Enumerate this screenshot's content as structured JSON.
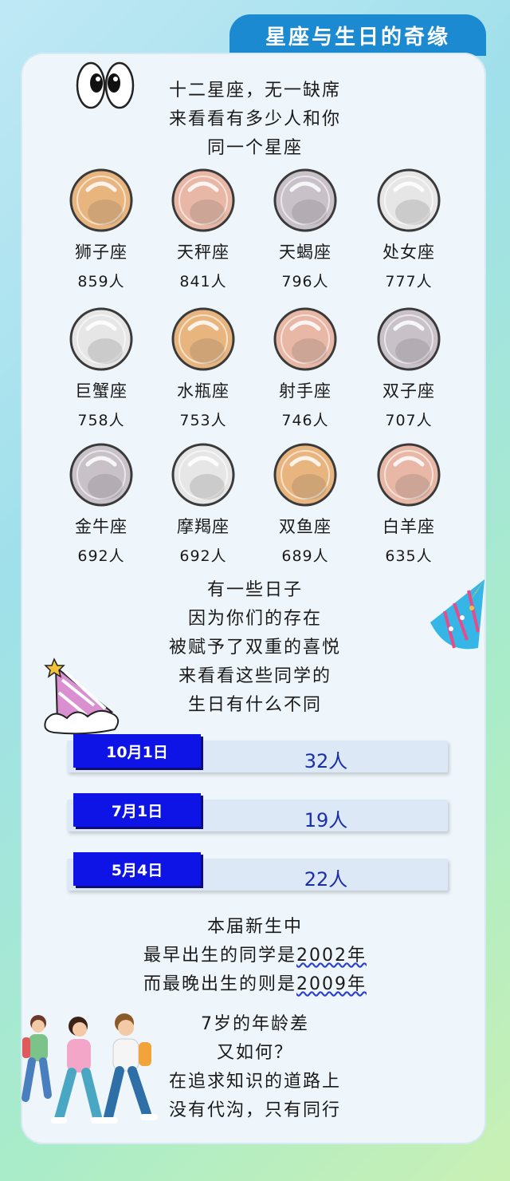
{
  "title": "星座与生日的奇缘",
  "intro": [
    "十二星座，无一缺席",
    "来看看有多少人和你",
    "同一个星座"
  ],
  "signs": [
    {
      "name": "狮子座",
      "count": "859人",
      "icon": "leo-icon"
    },
    {
      "name": "天秤座",
      "count": "841人",
      "icon": "libra-icon"
    },
    {
      "name": "天蝎座",
      "count": "796人",
      "icon": "scorpio-icon"
    },
    {
      "name": "处女座",
      "count": "777人",
      "icon": "virgo-icon"
    },
    {
      "name": "巨蟹座",
      "count": "758人",
      "icon": "cancer-icon"
    },
    {
      "name": "水瓶座",
      "count": "753人",
      "icon": "aquarius-icon"
    },
    {
      "name": "射手座",
      "count": "746人",
      "icon": "sagittarius-icon"
    },
    {
      "name": "双子座",
      "count": "707人",
      "icon": "gemini-icon"
    },
    {
      "name": "金牛座",
      "count": "692人",
      "icon": "taurus-icon"
    },
    {
      "name": "摩羯座",
      "count": "692人",
      "icon": "capricorn-icon"
    },
    {
      "name": "双鱼座",
      "count": "689人",
      "icon": "pisces-icon"
    },
    {
      "name": "白羊座",
      "count": "635人",
      "icon": "aries-icon"
    }
  ],
  "mid_text": [
    "有一些日子",
    "因为你们的存在",
    "被赋予了双重的喜悦",
    "来看看这些同学的",
    "生日有什么不同"
  ],
  "birthdays": [
    {
      "date": "10月1日",
      "count": "32人"
    },
    {
      "date": "7月1日",
      "count": "19人"
    },
    {
      "date": "5月4日",
      "count": "22人"
    }
  ],
  "years": {
    "line1": "本届新生中",
    "line2_prefix": "最早出生的同学是",
    "line2_year": "2002年",
    "line3_prefix": "而最晚出生的则是",
    "line3_year": "2009年"
  },
  "closing": [
    "7岁的年龄差",
    "又如何？",
    "在追求知识的道路上",
    "没有代沟，只有同行"
  ],
  "colors": {
    "accent": "#1b8ad0",
    "tag": "#0e14e6",
    "count_text": "#1a2fa8"
  }
}
